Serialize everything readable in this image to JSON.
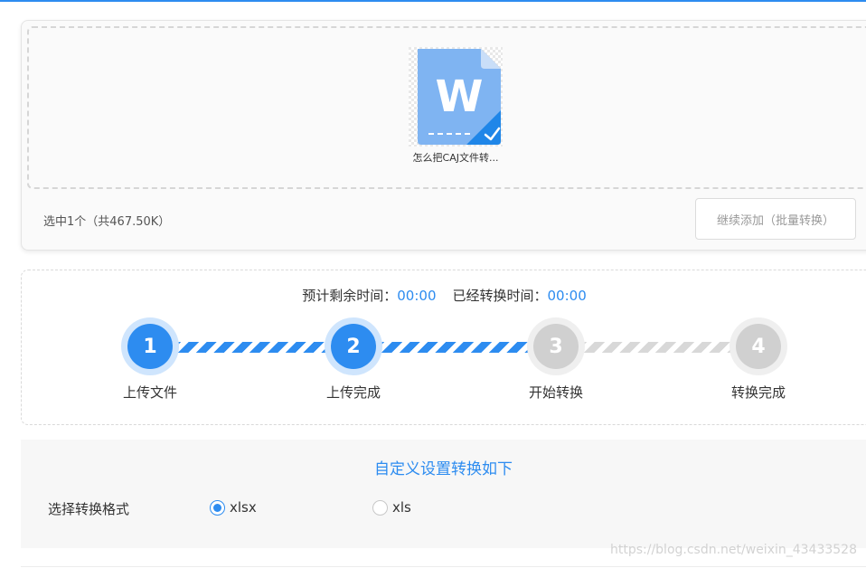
{
  "upload": {
    "file_name": "怎么把CAJ文件转...",
    "file_icon_letter": "W",
    "selected_info": "选中1个（共467.50K）",
    "add_more_label": "继续添加（批量转换）"
  },
  "progress": {
    "remaining_label": "预计剩余时间：",
    "remaining_value": "00:00",
    "elapsed_label": "已经转换时间：",
    "elapsed_value": "00:00",
    "steps": [
      {
        "number": "1",
        "label": "上传文件",
        "state": "active"
      },
      {
        "number": "2",
        "label": "上传完成",
        "state": "active"
      },
      {
        "number": "3",
        "label": "开始转换",
        "state": "pending"
      },
      {
        "number": "4",
        "label": "转换完成",
        "state": "pending"
      }
    ]
  },
  "settings": {
    "title": "自定义设置转换如下",
    "format_label": "选择转换格式",
    "options": [
      {
        "label": "xlsx",
        "checked": true
      },
      {
        "label": "xls",
        "checked": false
      }
    ]
  },
  "watermark": "https://blog.csdn.net/weixin_43433528",
  "colors": {
    "accent": "#2d8cf0",
    "step_pending": "#d0d0d0",
    "doc_icon": "#7fb4f2"
  }
}
